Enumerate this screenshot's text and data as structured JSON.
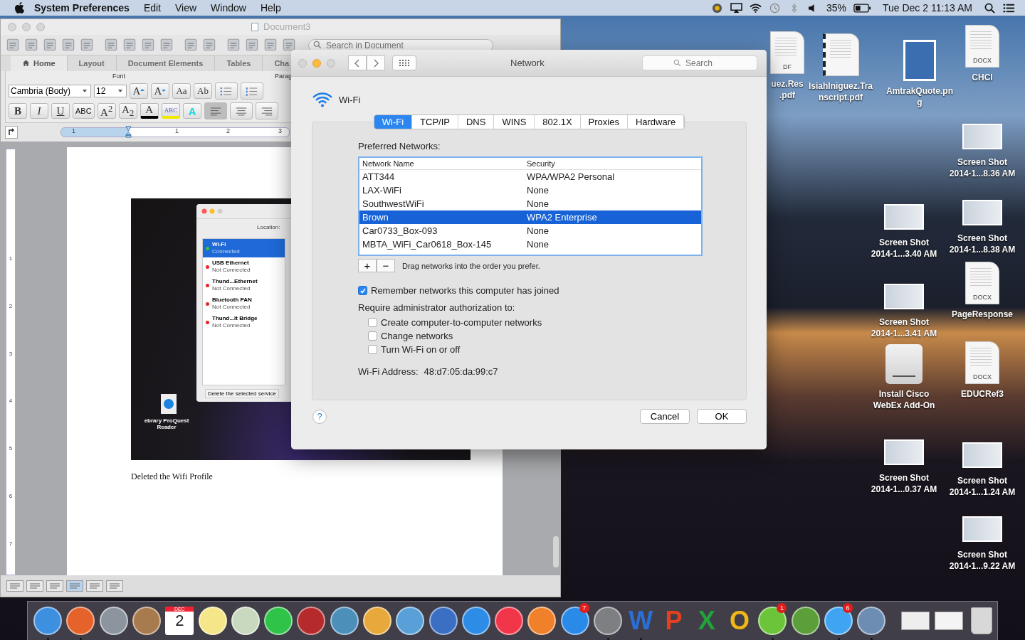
{
  "menu_bar": {
    "app": "System Preferences",
    "menus": [
      "Edit",
      "View",
      "Window",
      "Help"
    ],
    "battery": "35%",
    "clock": "Tue Dec 2  11:13 AM"
  },
  "word_window": {
    "title": "Document3",
    "search": {
      "placeholder": "Search in Document"
    },
    "ribbon_tabs": [
      {
        "label": "Home",
        "selected": true
      },
      {
        "label": "Layout",
        "selected": false
      },
      {
        "label": "Document Elements",
        "selected": false
      },
      {
        "label": "Tables",
        "selected": false
      },
      {
        "label": "Cha",
        "selected": false
      }
    ],
    "groups": [
      "Font",
      "Parag"
    ],
    "font": "Cambria (Body)",
    "size": "12",
    "row1_buttons": [
      {
        "kind": "grow",
        "label": "A"
      },
      {
        "kind": "shrink",
        "label": "A"
      },
      {
        "kind": "case",
        "label": "Aa"
      },
      {
        "kind": "spell",
        "label": "Ab"
      }
    ],
    "row2_buttons": [
      {
        "kind": "bold",
        "label": "B"
      },
      {
        "kind": "italic",
        "label": "I"
      },
      {
        "kind": "underline",
        "label": "U"
      },
      {
        "kind": "strike",
        "label": "ABC"
      },
      {
        "kind": "super",
        "label": "A$^{2}$"
      },
      {
        "kind": "sub",
        "label": "A$_{2}$"
      },
      {
        "kind": "color",
        "label": "A"
      },
      {
        "kind": "highlight",
        "label": "ABC"
      },
      {
        "kind": "effect",
        "label": "A"
      }
    ],
    "ruler": [
      "1",
      "1",
      "2",
      "3"
    ],
    "vruler": [
      "1",
      "2",
      "3",
      "4",
      "5",
      "6",
      "7"
    ],
    "embedded_screenshot": {
      "location": "Location:",
      "services": [
        {
          "name": "Wi-Fi",
          "status": "Connected",
          "selected": true,
          "color": "#3cc23c"
        },
        {
          "name": "USB Ethernet",
          "status": "Not Connected",
          "selected": false,
          "color": "#e8262b"
        },
        {
          "name": "Thund...Ethernet",
          "status": "Not Connected",
          "selected": false,
          "color": "#e8262b"
        },
        {
          "name": "Bluetooth PAN",
          "status": "Not Connected",
          "selected": false,
          "color": "#e8262b"
        },
        {
          "name": "Thund...lt Bridge",
          "status": "Not Connected",
          "selected": false,
          "color": "#e8262b"
        }
      ],
      "tooltip": "Delete the selected service",
      "desktop_icon": "ebrary ProQuest Reader"
    },
    "caption": "Deleted the Wifi Profile"
  },
  "network_dialog": {
    "title": "Network",
    "search": {
      "placeholder": "Search"
    },
    "heading": "Wi-Fi",
    "tabs": [
      {
        "label": "Wi-Fi",
        "selected": true
      },
      {
        "label": "TCP/IP",
        "selected": false
      },
      {
        "label": "DNS",
        "selected": false
      },
      {
        "label": "WINS",
        "selected": false
      },
      {
        "label": "802.1X",
        "selected": false
      },
      {
        "label": "Proxies",
        "selected": false
      },
      {
        "label": "Hardware",
        "selected": false
      }
    ],
    "preferred_label": "Preferred Networks:",
    "columns": [
      "Network Name",
      "Security"
    ],
    "rows": [
      {
        "name": "ATT344",
        "security": "WPA/WPA2 Personal",
        "selected": false
      },
      {
        "name": "LAX-WiFi",
        "security": "None",
        "selected": false
      },
      {
        "name": "SouthwestWiFi",
        "security": "None",
        "selected": false
      },
      {
        "name": "Brown",
        "security": "WPA2 Enterprise",
        "selected": true
      },
      {
        "name": "Car0733_Box-093",
        "security": "None",
        "selected": false
      },
      {
        "name": "MBTA_WiFi_Car0618_Box-145",
        "security": "None",
        "selected": false
      }
    ],
    "add": "+",
    "remove": "−",
    "drag_hint": "Drag networks into the order you prefer.",
    "remember": {
      "label": "Remember networks this computer has joined",
      "checked": true
    },
    "require_label": "Require administrator authorization to:",
    "options": [
      {
        "label": "Create computer-to-computer networks",
        "checked": false
      },
      {
        "label": "Change networks",
        "checked": false
      },
      {
        "label": "Turn Wi-Fi on or off",
        "checked": false
      }
    ],
    "address_label": "Wi-Fi Address:",
    "address": "48:d7:05:da:99:c7",
    "help": "?",
    "buttons": [
      "Cancel",
      "OK"
    ]
  },
  "desktop_icons": [
    {
      "kind": "pdf",
      "label": [
        "uez.Res",
        ".pdf"
      ],
      "badge": "DF"
    },
    {
      "kind": "pdf-bound",
      "label": [
        "IsiahIniguez.Tra",
        "nscript.pdf"
      ]
    },
    {
      "kind": "png",
      "label": [
        "AmtrakQuote.pn",
        "g"
      ]
    },
    {
      "kind": "docx",
      "label": [
        "CHCI"
      ],
      "badge": "DOCX"
    },
    {
      "kind": "screenshot",
      "label": [
        "Screen Shot",
        "2014-1...8.36 AM"
      ]
    },
    {
      "kind": "screenshot",
      "label": [
        "Screen Shot",
        "2014-1...3.40 AM"
      ]
    },
    {
      "kind": "screenshot",
      "label": [
        "Screen Shot",
        "2014-1...8.38 AM"
      ]
    },
    {
      "kind": "screenshot",
      "label": [
        "Screen Shot",
        "2014-1...3.41 AM"
      ]
    },
    {
      "kind": "docx",
      "label": [
        "PageResponse"
      ],
      "badge": "DOCX"
    },
    {
      "kind": "drive",
      "label": [
        "Install Cisco",
        "WebEx Add-On"
      ]
    },
    {
      "kind": "docx",
      "label": [
        "EDUCRef3"
      ],
      "badge": "DOCX"
    },
    {
      "kind": "screenshot",
      "label": [
        "Screen Shot",
        "2014-1...0.37 AM"
      ]
    },
    {
      "kind": "screenshot",
      "label": [
        "Screen Shot",
        "2014-1...1.24 AM"
      ]
    },
    {
      "kind": "screenshot",
      "label": [
        "Screen Shot",
        "2014-1...9.22 AM"
      ]
    }
  ],
  "dock": [
    {
      "kind": "app",
      "color": "#3d8fe0",
      "running": true
    },
    {
      "kind": "app",
      "color": "#e5622a",
      "running": true
    },
    {
      "kind": "app",
      "color": "#8c959e",
      "running": false
    },
    {
      "kind": "app",
      "color": "#a87b4f",
      "running": false
    },
    {
      "kind": "calendar",
      "month": "DEC",
      "day": "2",
      "running": false
    },
    {
      "kind": "app",
      "color": "#f6e68a",
      "running": false
    },
    {
      "kind": "app",
      "color": "#c9d9c0",
      "running": false
    },
    {
      "kind": "app",
      "color": "#2fc34a",
      "running": false
    },
    {
      "kind": "app",
      "color": "#b52a2a",
      "running": false
    },
    {
      "kind": "app",
      "color": "#4c8fb8",
      "running": false
    },
    {
      "kind": "app",
      "color": "#e8a93c",
      "running": false
    },
    {
      "kind": "app",
      "color": "#5aa0d8",
      "running": false
    },
    {
      "kind": "app",
      "color": "#3a6fc4",
      "running": false
    },
    {
      "kind": "app",
      "color": "#2d8ce6",
      "running": false
    },
    {
      "kind": "app",
      "color": "#f2364a",
      "running": false
    },
    {
      "kind": "app",
      "color": "#f0802a",
      "running": false
    },
    {
      "kind": "app",
      "color": "#2a8ae8",
      "running": false,
      "badge": "7"
    },
    {
      "kind": "app",
      "color": "#7d7f83",
      "running": true
    },
    {
      "kind": "letter",
      "glyph": "W",
      "color": "#2a6fd6",
      "running": true
    },
    {
      "kind": "letter",
      "glyph": "P",
      "color": "#e2401f",
      "running": false
    },
    {
      "kind": "letter",
      "glyph": "X",
      "color": "#21a33a",
      "running": false
    },
    {
      "kind": "letter",
      "glyph": "O",
      "color": "#f0b816",
      "running": false
    },
    {
      "kind": "app",
      "color": "#6cc43a",
      "running": true,
      "badge": "1"
    },
    {
      "kind": "app",
      "color": "#5b9e3a",
      "running": false
    },
    {
      "kind": "app",
      "color": "#3fa5f2",
      "running": true,
      "badge": "6"
    },
    {
      "kind": "app",
      "color": "#6d8db3",
      "running": true
    },
    {
      "kind": "doc",
      "color": "#eeeeee",
      "running": false
    },
    {
      "kind": "doc",
      "color": "#f4f4f4",
      "running": false
    },
    {
      "kind": "trash",
      "color": "#d8d8d8",
      "running": false
    }
  ]
}
